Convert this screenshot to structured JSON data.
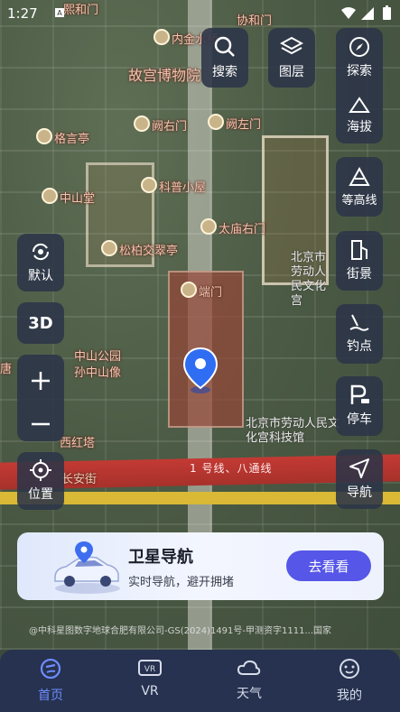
{
  "status_bar": {
    "time": "1:27"
  },
  "map": {
    "places": {
      "p1": "内金水桥",
      "p2": "协和门",
      "p3": "熙和门",
      "p4": "故宫博物院",
      "p5": "阙右门",
      "p6": "阙左门",
      "p7": "格言亭",
      "p8": "科普小屋",
      "p9": "中山堂",
      "p10": "太庙右门",
      "p11": "松柏交翠亭",
      "p12": "端门",
      "p13": "中山公园",
      "p14": "孙中山像",
      "p15": "西红塔",
      "p16": "北京市劳动人民文化宫",
      "p17": "北京市劳动人民文化宫科技馆",
      "p18": "长安街",
      "p19": "唐"
    },
    "subway_label": "1 号线、八通线",
    "credit": "@中科星图数字地球合肥有限公司-GS(2024)1491号-甲测资字1111...国家"
  },
  "tools": {
    "search": "搜索",
    "layers": "图层",
    "explore": "探索",
    "altitude": "海拔",
    "contour": "等高线",
    "streetview": "街景",
    "fishing": "钓点",
    "parking": "停车",
    "navigate": "导航",
    "default": "默认",
    "three_d": "3D",
    "location": "位置"
  },
  "promo": {
    "title": "卫星导航",
    "subtitle": "实时导航，避开拥堵",
    "action": "去看看"
  },
  "nav": {
    "home": "首页",
    "vr": "VR",
    "weather": "天气",
    "mine": "我的"
  },
  "colors": {
    "accent": "#5656e8",
    "nav_active": "#6f8cff",
    "button_bg": "#2c3448",
    "subway_red": "#c33a34"
  }
}
